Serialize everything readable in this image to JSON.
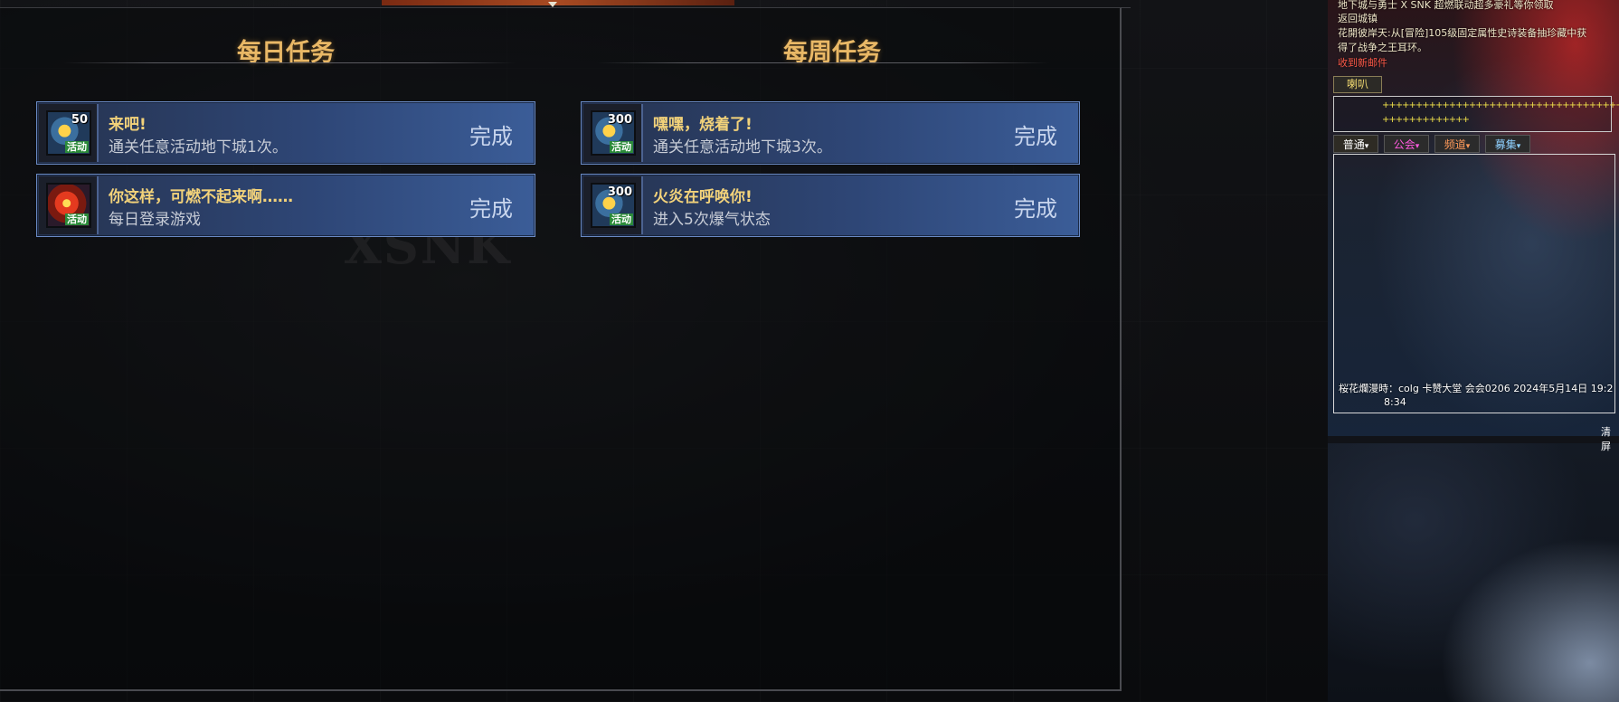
{
  "daily": {
    "title": "每日任务",
    "quests": [
      {
        "name": "来吧!",
        "desc": "通关任意活动地下城1次。",
        "status": "完成",
        "points": "50",
        "badge": "活动",
        "icon": "activity-coin-icon"
      },
      {
        "name": "你这样，可燃不起来啊……",
        "desc": "每日登录游戏",
        "status": "完成",
        "points": "",
        "badge": "活动",
        "icon": "activity-fire-icon"
      }
    ]
  },
  "weekly": {
    "title": "每周任务",
    "quests": [
      {
        "name": "嘿嘿，烧着了!",
        "desc": "通关任意活动地下城3次。",
        "status": "完成",
        "points": "300",
        "badge": "活动",
        "icon": "activity-coin-icon"
      },
      {
        "name": "火炎在呼唤你!",
        "desc": "进入5次爆气状态",
        "status": "完成",
        "points": "300",
        "badge": "活动",
        "icon": "activity-coin-icon"
      }
    ]
  },
  "chat": {
    "system_lines": [
      "地下城与勇士 X SNK 超燃联动超多豪礼等你领取",
      "返回城镇",
      "花開彼岸天:从[冒险]105级固定属性史诗装备抽珍藏中获",
      "得了战争之王耳环。"
    ],
    "mail_notice": "收到新邮件",
    "horn_label": "喇叭",
    "horn_line1": "++++++++++++++++++++++++++++++++++++++++",
    "horn_line2": "+++++++++++++",
    "tabs": [
      {
        "label": "普通",
        "color": "#ffffff"
      },
      {
        "label": "公会",
        "color": "#ff5adf"
      },
      {
        "label": "频道",
        "color": "#ff9a5a"
      },
      {
        "label": "募集",
        "color": "#8fd0ff"
      }
    ],
    "message_line1": "桜花爛漫時：colg 卡赞大堂 会会0206 2024年5月14日 19:2",
    "message_line2": "8:34",
    "clear_label": "清屏"
  },
  "watermark": "XSNK"
}
